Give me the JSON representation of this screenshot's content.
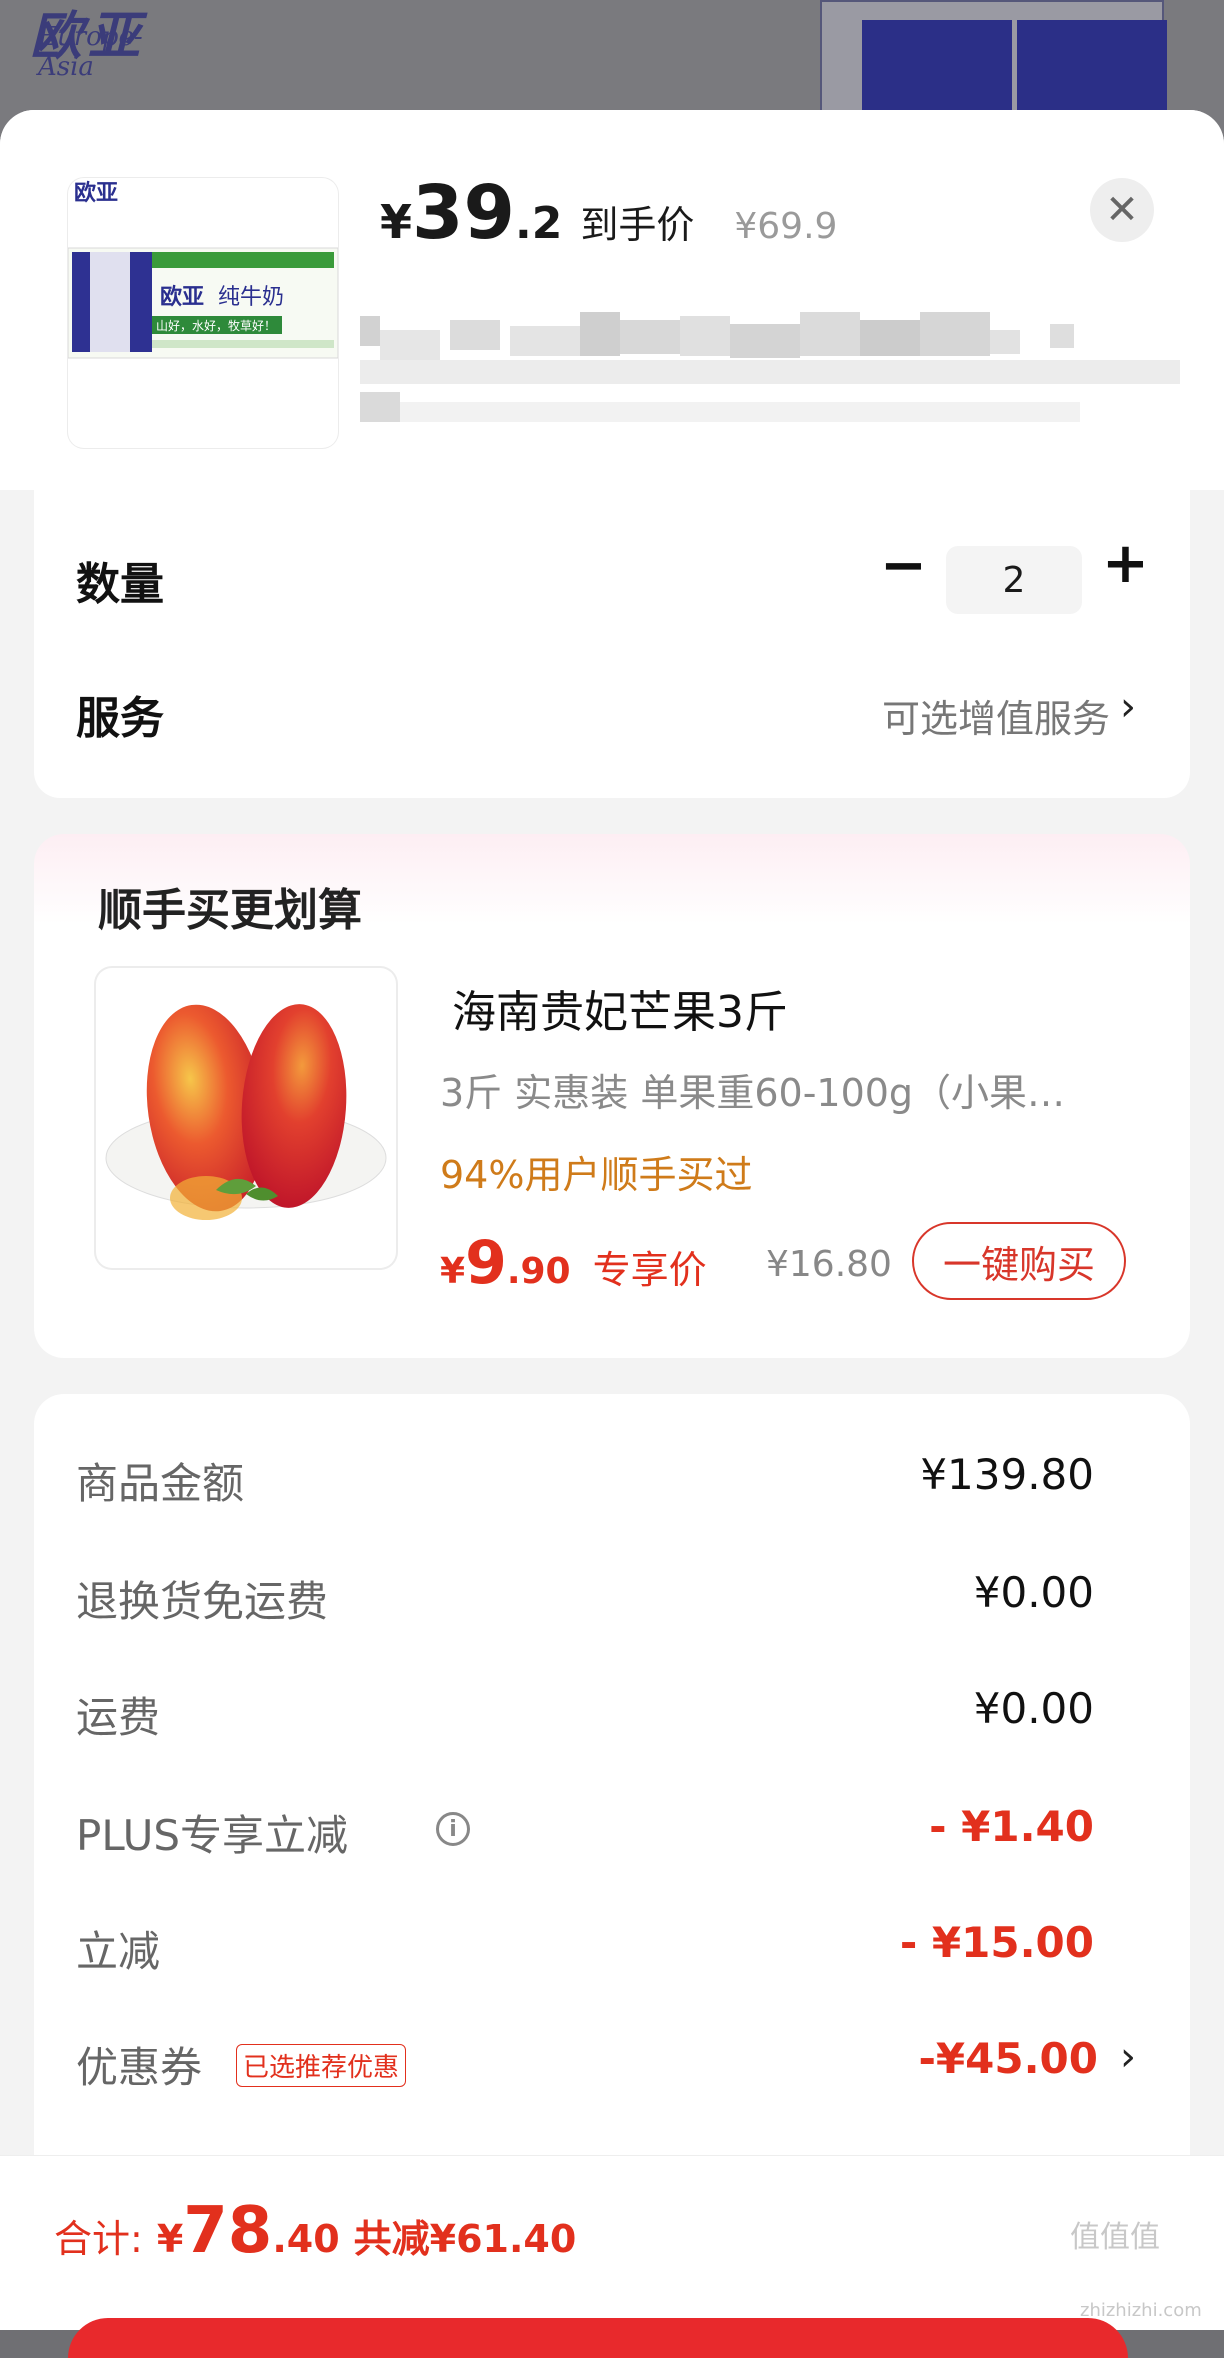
{
  "background": {
    "logo_cn": "欧亚",
    "logo_en": "Europe-Asia"
  },
  "product": {
    "currency": "¥",
    "price_int": "39",
    "price_dec": ".2",
    "price_label": "到手价",
    "original_price": "¥69.9",
    "close_icon": "close-icon",
    "package_brand": "欧亚",
    "package_name": "纯牛奶",
    "package_slogan": "山好，水好，牧草好！"
  },
  "options": {
    "quantity_label": "数量",
    "quantity_value": "2",
    "service_label": "服务",
    "service_value": "可选增值服务"
  },
  "upsell": {
    "title": "顺手买更划算",
    "name": "海南贵妃芒果3斤",
    "spec": "3斤 实惠装   单果重60-100g（小果…",
    "social_proof": "94%用户顺手买过",
    "currency": "¥",
    "price_int": "9",
    "price_dec": ".90",
    "price_label": "专享价",
    "original_price": "¥16.80",
    "buy_button": "一键购买"
  },
  "fees": {
    "goods_label": "商品金额",
    "goods_value": "¥139.80",
    "return_label": "退换货免运费",
    "return_value": "¥0.00",
    "shipping_label": "运费",
    "shipping_value": "¥0.00",
    "plus_label": "PLUS专享立减",
    "plus_value": "- ¥1.40",
    "discount_label": "立减",
    "discount_value": "- ¥15.00",
    "coupon_label": "优惠券",
    "coupon_tag": "已选推荐优惠",
    "coupon_value": "-¥45.00"
  },
  "footer": {
    "total_label": "合计:",
    "currency": "¥",
    "total_int": "78",
    "total_dec": ".40",
    "saved": "共减¥61.40"
  },
  "watermark": {
    "text": "值值值",
    "url": "zhizhizhi.com"
  },
  "colors": {
    "accent_red": "#e2301d",
    "social_orange": "#cf7b1a"
  }
}
